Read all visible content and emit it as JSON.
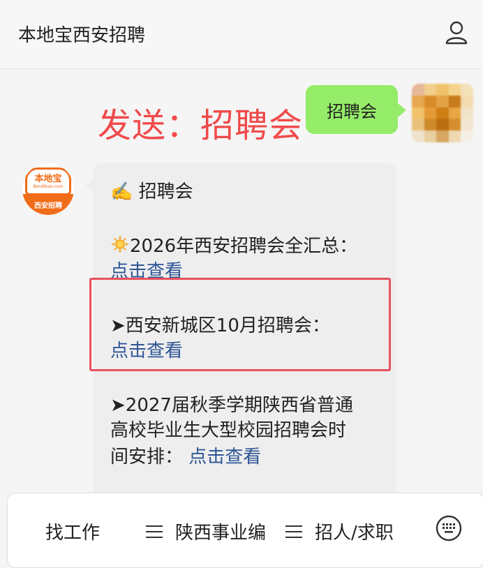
{
  "header": {
    "title": "本地宝西安招聘",
    "user_icon": "user-icon"
  },
  "chat": {
    "user_message": "招聘会",
    "instruction": "发送：招聘会",
    "bot": {
      "avatar_name": "本地宝",
      "avatar_url": "Bendibao.com",
      "avatar_caption": "西安招聘"
    },
    "reply": {
      "heading_icon": "✍️",
      "heading": "招聘会",
      "items": [
        {
          "icon": "sun-icon",
          "text": "2026年西安招聘会全汇总：",
          "link": "点击查看"
        },
        {
          "icon": "arrow-icon",
          "arrow": "➤",
          "text": "西安新城区10月招聘会：",
          "link": "点击查看"
        },
        {
          "icon": "arrow-icon",
          "arrow": "➤",
          "text_lines": [
            "2027届秋季学期陕西省普通",
            "高校毕业生大型校园招聘会时",
            "间安排："
          ],
          "link": "点击查看"
        }
      ]
    }
  },
  "bottom_menu": {
    "tabs": [
      "找工作",
      "陕西事业编",
      "招人/求职"
    ],
    "keyboard_icon": "keyboard-icon"
  },
  "colors": {
    "user_bubble": "#95ec69",
    "highlight": "#f04a4a",
    "link": "#2f5695",
    "brand": "#f06c18"
  }
}
